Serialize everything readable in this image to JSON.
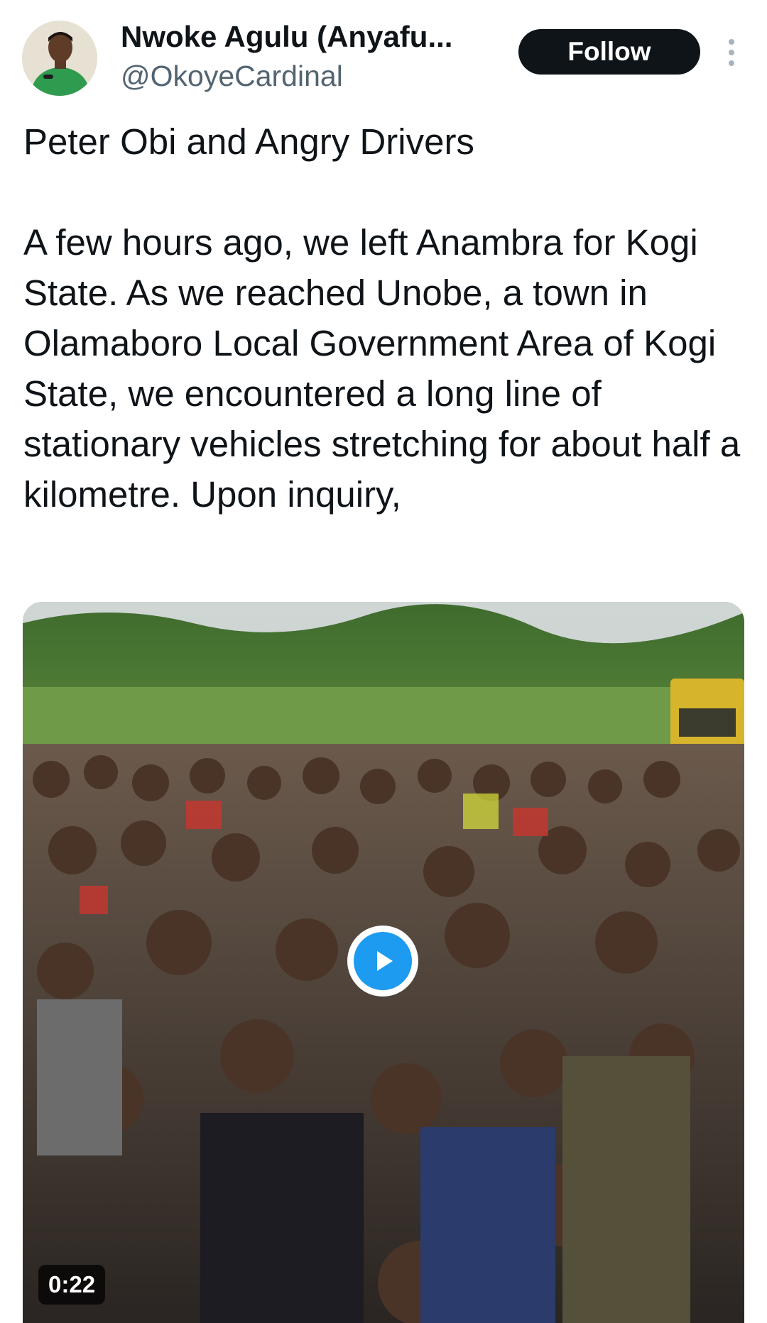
{
  "author": {
    "display_name": "Nwoke Agulu (Anyafu...",
    "handle": "@OkoyeCardinal",
    "avatar_icon": "profile-avatar"
  },
  "header": {
    "follow_label": "Follow",
    "more_icon": "more-vertical-icon"
  },
  "tweet": {
    "paragraphs": [
      "Peter Obi and Angry Drivers",
      "A few hours ago, we left Anambra for Kogi State. As we reached Unobe, a town in Olamaboro Local Government Area of Kogi State, we encountered a long line of stationary vehicles stretching for about half a kilometre. Upon inquiry,"
    ]
  },
  "media": {
    "type": "video",
    "duration": "0:22",
    "play_icon": "play-icon"
  },
  "colors": {
    "accent": "#1d9bf0",
    "text": "#0f1419",
    "secondary_text": "#536471",
    "follow_bg": "#0f1419"
  }
}
